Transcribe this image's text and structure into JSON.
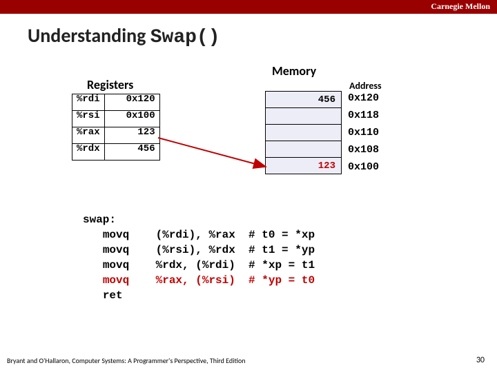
{
  "header": {
    "institution": "Carnegie Mellon"
  },
  "title": {
    "prefix": "Understanding ",
    "func": "Swap()"
  },
  "labels": {
    "registers": "Registers",
    "memory": "Memory",
    "address": "Address"
  },
  "registers": [
    {
      "name": "%rdi",
      "value": "0x120"
    },
    {
      "name": "%rsi",
      "value": "0x100"
    },
    {
      "name": "%rax",
      "value": "123"
    },
    {
      "name": "%rdx",
      "value": "456"
    }
  ],
  "memory": {
    "cells": [
      {
        "value": "456",
        "hl": false
      },
      {
        "value": "",
        "hl": false
      },
      {
        "value": "",
        "hl": false
      },
      {
        "value": "",
        "hl": false
      },
      {
        "value": "123",
        "hl": true
      }
    ],
    "addresses": [
      "0x120",
      "0x118",
      "0x110",
      "0x108",
      "0x100"
    ]
  },
  "code": {
    "label": "swap:",
    "lines": [
      {
        "instr": "movq",
        "args": "(%rdi), %rax",
        "comment": "# t0 = *xp",
        "hl": false
      },
      {
        "instr": "movq",
        "args": "(%rsi), %rdx",
        "comment": "# t1 = *yp",
        "hl": false
      },
      {
        "instr": "movq",
        "args": "%rdx, (%rdi)",
        "comment": "# *xp = t1",
        "hl": false
      },
      {
        "instr": "movq",
        "args": "%rax, (%rsi)",
        "comment": "# *yp = t0",
        "hl": true
      },
      {
        "instr": "ret",
        "args": "",
        "comment": "",
        "hl": false
      }
    ]
  },
  "footer": {
    "text": "Bryant and O'Hallaron, Computer Systems: A Programmer's Perspective, Third Edition",
    "page": "30"
  }
}
